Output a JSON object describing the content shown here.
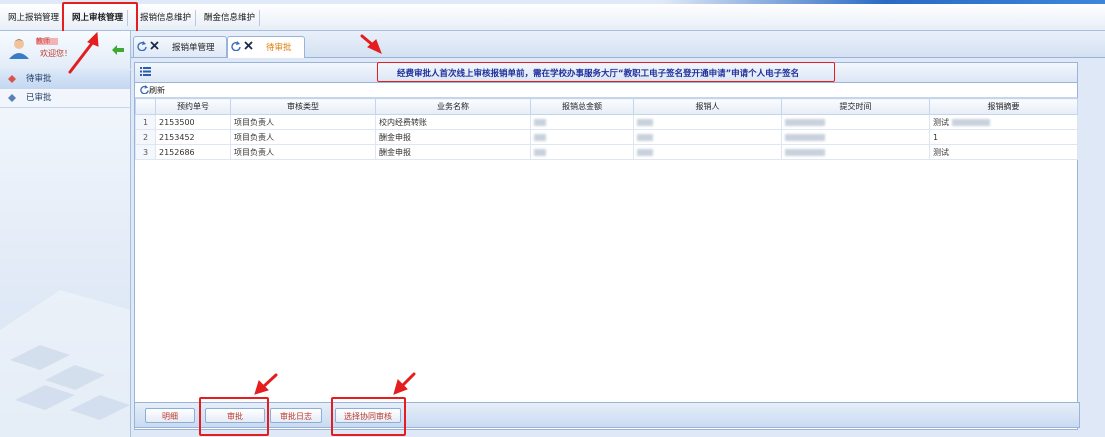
{
  "menu": {
    "items": [
      "网上报销管理",
      "网上审核管理",
      "报销信息维护",
      "酬金信息维护"
    ],
    "active_index": 1
  },
  "user": {
    "name": "教师",
    "welcome": "欢迎您！"
  },
  "sidebar": {
    "items": [
      {
        "label": "待审批",
        "active": true
      },
      {
        "label": "已审批",
        "active": false
      }
    ]
  },
  "tabs": [
    {
      "label": "报销单管理",
      "active": false
    },
    {
      "label": "待审批",
      "active": true
    }
  ],
  "notice": {
    "text": "经费审批人首次线上审核报销单前，需在学校办事服务大厅“教职工电子签名登开通申请”申请个人电子签名"
  },
  "toolbar": {
    "refresh_label": "刷新"
  },
  "table": {
    "columns": [
      "预约单号",
      "审核类型",
      "业务名称",
      "报销总金额",
      "报销人",
      "提交时间",
      "报销摘要"
    ],
    "rows": [
      {
        "index": "1",
        "order_no": "2153500",
        "audit_type": "项目负责人",
        "business": "校内经费转账",
        "amount": "",
        "person": "",
        "time": "",
        "summary": "测试"
      },
      {
        "index": "2",
        "order_no": "2153452",
        "audit_type": "项目负责人",
        "business": "酬金申报",
        "amount": "",
        "person": "",
        "time": "",
        "summary": "1"
      },
      {
        "index": "3",
        "order_no": "2152686",
        "audit_type": "项目负责人",
        "business": "酬金申报",
        "amount": "",
        "person": "",
        "time": "",
        "summary": "测试"
      }
    ]
  },
  "buttons": {
    "detail": "明细",
    "approve": "审批",
    "log": "审批日志",
    "cosign": "选择协同审核"
  },
  "colors": {
    "annotation": "#e41e1e",
    "notice_text": "#1f2f9a",
    "active_tab": "#e07b00",
    "button_text": "#c0392b"
  }
}
